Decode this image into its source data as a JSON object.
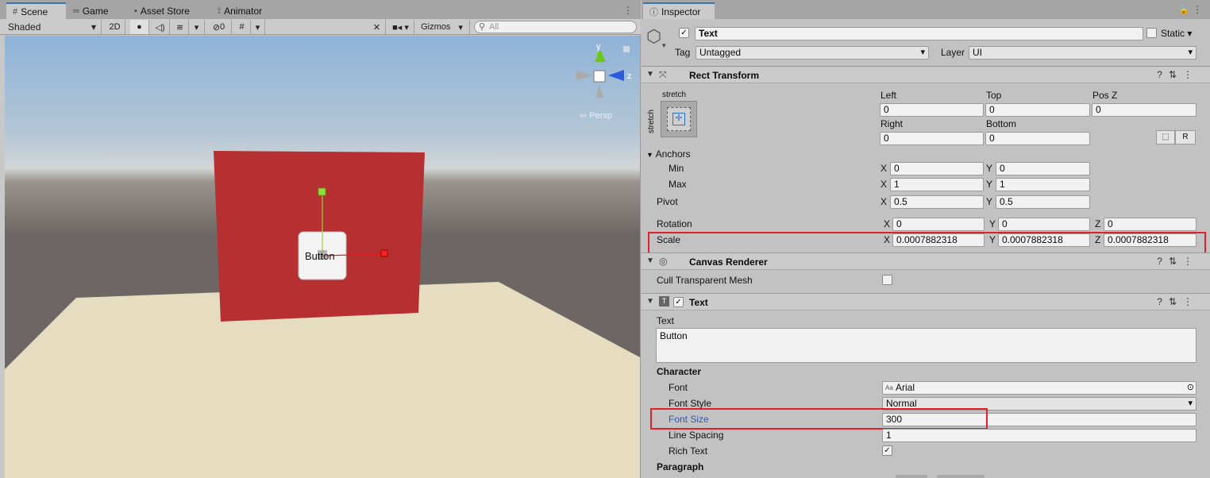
{
  "scene_tabs": [
    {
      "label": "Scene",
      "icon": "#"
    },
    {
      "label": "Game",
      "icon": "∞"
    },
    {
      "label": "Asset Store",
      "icon": "🛍"
    },
    {
      "label": "Animator",
      "icon": "⚲"
    }
  ],
  "scene_toolbar": {
    "shading": "Shaded",
    "mode_2d": "2D",
    "hidden_count": "0",
    "gizmos": "Gizmos",
    "search_placeholder": "All"
  },
  "viewport": {
    "persp_label": "Persp",
    "gizmo_y": "y",
    "gizmo_z": "z",
    "button_text": "Button"
  },
  "inspector": {
    "tab_label": "Inspector",
    "object_name": "Text",
    "static_label": "Static",
    "tag_label": "Tag",
    "tag_value": "Untagged",
    "layer_label": "Layer",
    "layer_value": "UI",
    "rect_transform": {
      "title": "Rect Transform",
      "stretch_h": "stretch",
      "stretch_v": "stretch",
      "left_label": "Left",
      "left": "0",
      "top_label": "Top",
      "top": "0",
      "posz_label": "Pos Z",
      "posz": "0",
      "right_label": "Right",
      "right": "0",
      "bottom_label": "Bottom",
      "bottom": "0",
      "r_button": "R",
      "anchors_label": "Anchors",
      "min_label": "Min",
      "min_x": "0",
      "min_y": "0",
      "max_label": "Max",
      "max_x": "1",
      "max_y": "1",
      "pivot_label": "Pivot",
      "pivot_x": "0.5",
      "pivot_y": "0.5",
      "rotation_label": "Rotation",
      "rot_x": "0",
      "rot_y": "0",
      "rot_z": "0",
      "scale_label": "Scale",
      "scale_x": "0.0007882318",
      "scale_y": "0.0007882318",
      "scale_z": "0.0007882318",
      "x": "X",
      "y": "Y",
      "z": "Z"
    },
    "canvas_renderer": {
      "title": "Canvas Renderer",
      "cull_label": "Cull Transparent Mesh"
    },
    "text_comp": {
      "title": "Text",
      "text_label": "Text",
      "text_value": "Button",
      "character_label": "Character",
      "font_label": "Font",
      "font_value": "Arial",
      "font_style_label": "Font Style",
      "font_style_value": "Normal",
      "font_size_label": "Font Size",
      "font_size_value": "300",
      "line_spacing_label": "Line Spacing",
      "line_spacing_value": "1",
      "rich_text_label": "Rich Text",
      "paragraph_label": "Paragraph"
    }
  },
  "colors": {
    "panel_red": "#b62f31",
    "floor": "#e6dcbf",
    "highlight": "#e0202a",
    "accent_blue": "#3a72b0"
  }
}
